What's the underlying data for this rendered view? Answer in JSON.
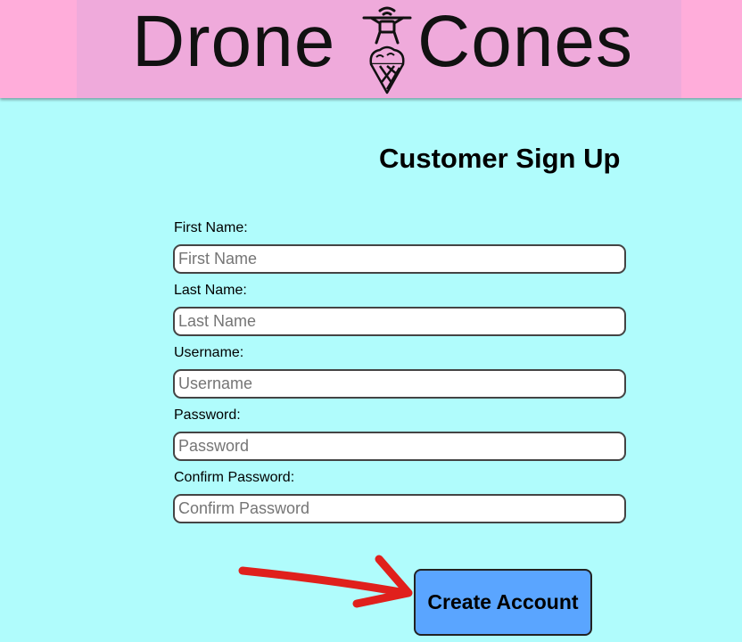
{
  "brand": {
    "word_left": "Drone",
    "word_right": "Cones"
  },
  "form": {
    "title": "Customer Sign Up",
    "fields": [
      {
        "label": "First Name:",
        "placeholder": "First Name"
      },
      {
        "label": "Last Name:",
        "placeholder": "Last Name"
      },
      {
        "label": "Username:",
        "placeholder": "Username"
      },
      {
        "label": "Password:",
        "placeholder": "Password"
      },
      {
        "label": "Confirm Password:",
        "placeholder": "Confirm Password"
      }
    ],
    "submit_label": "Create Account"
  },
  "annotation": {
    "arrow_color": "#e0201c",
    "arrow_target": "create-account-button"
  },
  "colors": {
    "header_bg": "#ffadda",
    "logo_panel_bg": "#efaadb",
    "page_bg": "#b0fcfc",
    "button_bg": "#5aa5ff"
  }
}
